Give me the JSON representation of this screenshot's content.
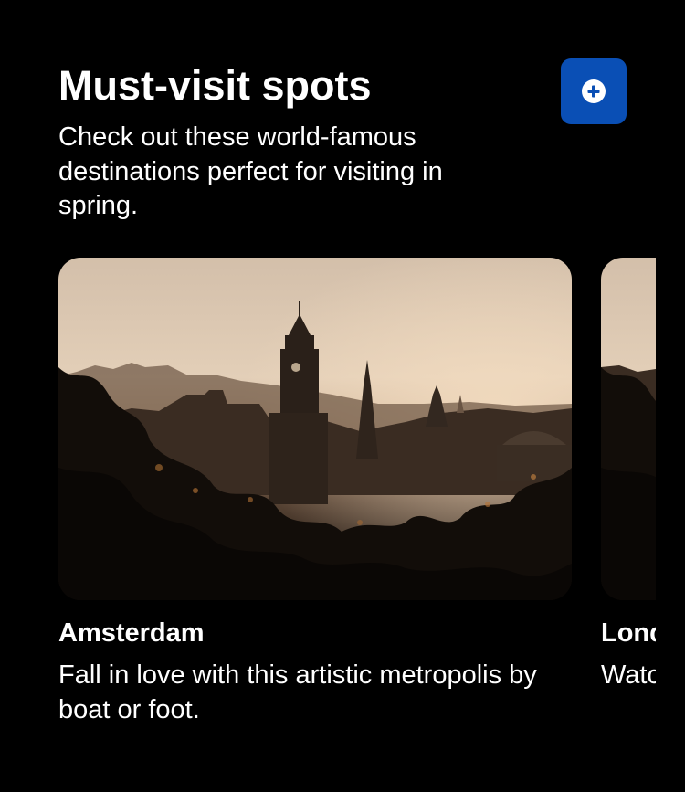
{
  "header": {
    "title": "Must-visit spots",
    "subtitle": "Check out these world-famous destinations perfect for visiting in spring.",
    "add_button_icon": "plus-circle-icon"
  },
  "colors": {
    "background": "#000000",
    "accent": "#0A4FB5",
    "text": "#FFFFFF"
  },
  "destinations": [
    {
      "name": "Amsterdam",
      "description": "Fall in love with this artistic metropolis by boat or foot.",
      "image": "city-skyline-sunset-photo"
    },
    {
      "name": "London",
      "description": "Watch the world go by",
      "image": "city-skyline-sunset-photo"
    }
  ]
}
